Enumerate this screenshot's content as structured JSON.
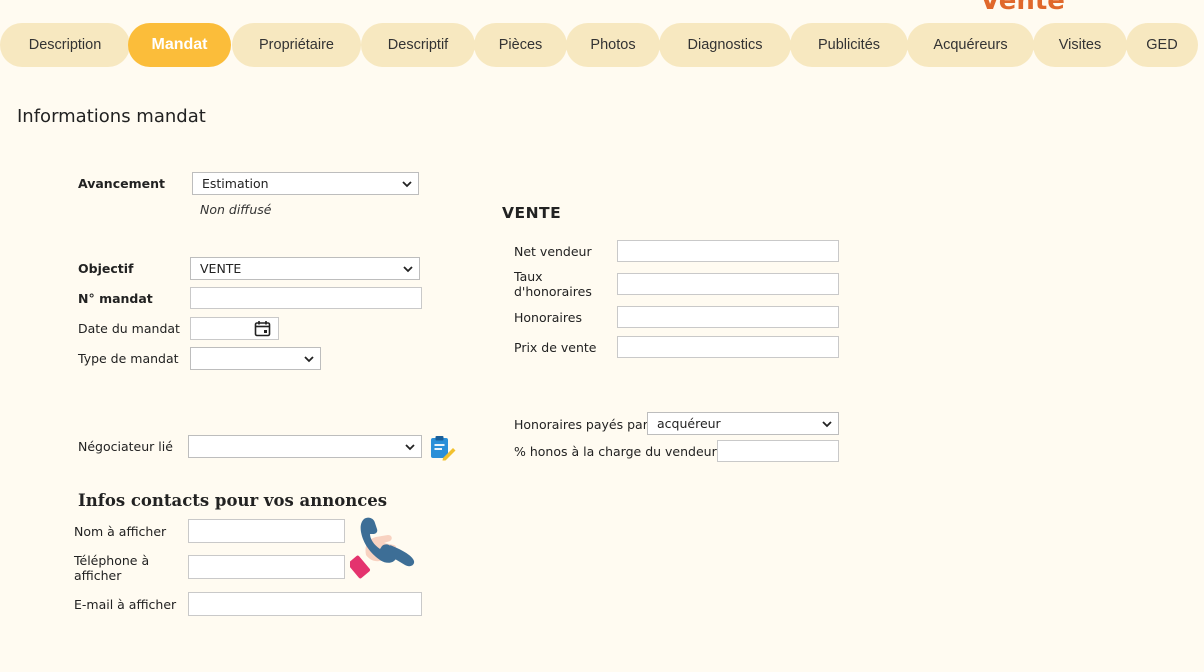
{
  "header": {
    "fragment": "Vente"
  },
  "tabs": [
    {
      "label": "Description"
    },
    {
      "label": "Mandat"
    },
    {
      "label": "Propriétaire"
    },
    {
      "label": "Descriptif"
    },
    {
      "label": "Pièces"
    },
    {
      "label": "Photos"
    },
    {
      "label": "Diagnostics"
    },
    {
      "label": "Publicités"
    },
    {
      "label": "Acquéreurs"
    },
    {
      "label": "Visites"
    },
    {
      "label": "GED"
    }
  ],
  "active_tab": "Mandat",
  "section_title": "Informations mandat",
  "form": {
    "avancement": {
      "label": "Avancement",
      "value": "Estimation",
      "note": "Non diffusé"
    },
    "objectif": {
      "label": "Objectif",
      "value": "VENTE"
    },
    "numero_mandat": {
      "label": "N° mandat",
      "value": ""
    },
    "date_mandat": {
      "label": "Date du mandat",
      "value": ""
    },
    "type_mandat": {
      "label": "Type de mandat",
      "value": ""
    },
    "negociateur": {
      "label": "Négociateur lié",
      "value": ""
    }
  },
  "vente": {
    "heading": "VENTE",
    "net_vendeur": {
      "label": "Net vendeur",
      "value": ""
    },
    "taux_honoraires": {
      "label": "Taux d'honoraires",
      "value": ""
    },
    "honoraires": {
      "label": "Honoraires",
      "value": ""
    },
    "prix_vente": {
      "label": "Prix de vente",
      "value": ""
    },
    "honoraires_payes_par": {
      "label": "Honoraires payés par",
      "value": "acquéreur"
    },
    "honos_vendeur": {
      "label": "% honos à la charge du vendeur",
      "value": ""
    }
  },
  "contacts": {
    "heading": "Infos contacts pour vos annonces",
    "nom": {
      "label": "Nom à afficher",
      "value": ""
    },
    "telephone": {
      "label": "Téléphone à afficher",
      "value": ""
    },
    "email": {
      "label": "E-mail à afficher",
      "value": ""
    }
  },
  "colors": {
    "active_tab": "#fbbd3a",
    "tab": "#f7e8c0",
    "background": "#fffbf1",
    "accent": "#e0682b"
  }
}
